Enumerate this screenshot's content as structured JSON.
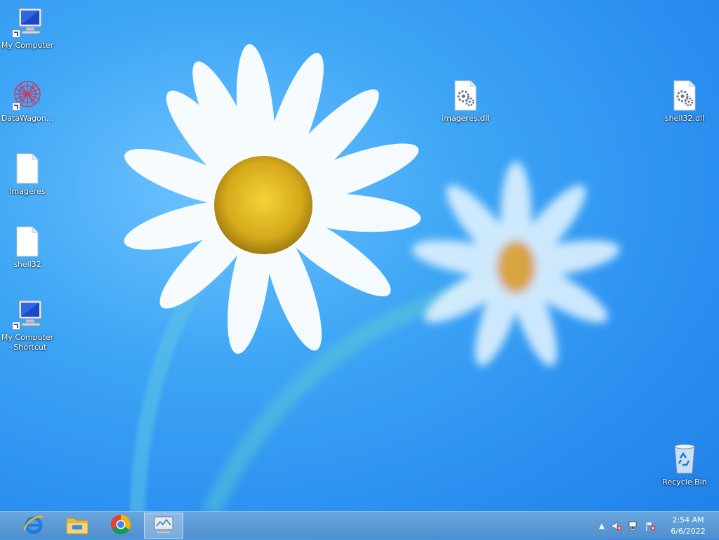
{
  "desktop": {
    "icons": [
      {
        "label": "My Computer",
        "icon": "computer-icon"
      },
      {
        "label": "DataWagon...",
        "icon": "datawagon-icon"
      },
      {
        "label": "imageres",
        "icon": "blank-file-icon"
      },
      {
        "label": "shell32",
        "icon": "blank-file-icon"
      },
      {
        "label": "My Computer - Shortcut",
        "icon": "computer-icon"
      },
      {
        "label": "imageres.dll",
        "icon": "dll-file-icon"
      },
      {
        "label": "shell32.dll",
        "icon": "dll-file-icon"
      },
      {
        "label": "Recycle Bin",
        "icon": "recycle-bin-icon"
      }
    ]
  },
  "taskbar": {
    "apps": [
      {
        "name": "Internet Explorer",
        "icon": "internet-explorer-icon"
      },
      {
        "name": "File Explorer",
        "icon": "file-explorer-icon"
      },
      {
        "name": "Google Chrome",
        "icon": "chrome-icon"
      },
      {
        "name": "Active Window",
        "icon": "monitor-app-icon"
      }
    ],
    "tray": {
      "icons": [
        "show-hidden-icons-arrow-icon",
        "volume-muted-icon",
        "network-icon",
        "action-center-flag-icon"
      ]
    },
    "clock": {
      "time": "2:54 AM",
      "date": "6/6/2022"
    }
  }
}
